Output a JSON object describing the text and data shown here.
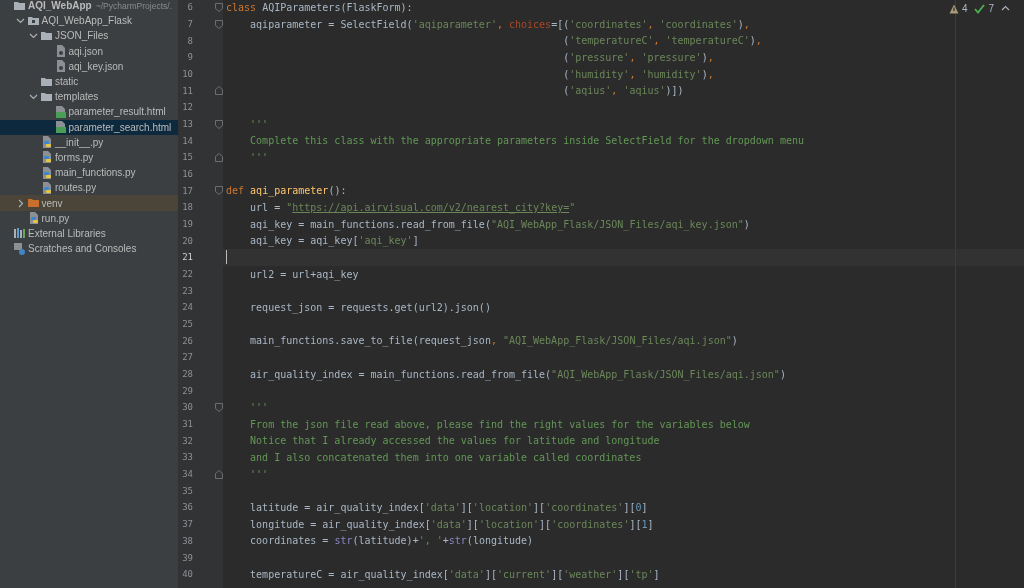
{
  "project_tree": {
    "items": [
      {
        "kind": "project",
        "name": "AQI_WebApp",
        "hint": "~/PycharmProjects/.",
        "selected": false,
        "children": [
          {
            "kind": "module",
            "name": "AQI_WebApp_Flask",
            "expanded": true,
            "selected": false,
            "children": [
              {
                "kind": "folder",
                "name": "JSON_Files",
                "expanded": true,
                "selected": false,
                "children": [
                  {
                    "kind": "json",
                    "name": "aqi.json",
                    "selected": false
                  },
                  {
                    "kind": "json",
                    "name": "aqi_key.json",
                    "selected": false
                  }
                ]
              },
              {
                "kind": "folder",
                "name": "static",
                "selected": false
              },
              {
                "kind": "folder",
                "name": "templates",
                "expanded": true,
                "selected": false,
                "children": [
                  {
                    "kind": "html",
                    "name": "parameter_result.html",
                    "selected": false
                  },
                  {
                    "kind": "html",
                    "name": "parameter_search.html",
                    "selected": true
                  }
                ]
              },
              {
                "kind": "python",
                "name": "__init__.py",
                "selected": false
              },
              {
                "kind": "python",
                "name": "forms.py",
                "selected": false
              },
              {
                "kind": "python",
                "name": "main_functions.py",
                "selected": false
              },
              {
                "kind": "python",
                "name": "routes.py",
                "selected": false
              }
            ]
          },
          {
            "kind": "venv",
            "name": "venv",
            "expanded": false,
            "selected": false
          },
          {
            "kind": "python",
            "name": "run.py",
            "selected": false
          }
        ]
      },
      {
        "kind": "library",
        "name": "External Libraries",
        "selected": false
      },
      {
        "kind": "scratches",
        "name": "Scratches and Consoles",
        "selected": false
      }
    ]
  },
  "inspections": {
    "warnings": "4",
    "weak_warnings": "7"
  },
  "editor": {
    "lines": [
      {
        "number": "6",
        "kind": "fold_start",
        "current": false,
        "tokens": [
          {
            "kind": "kw",
            "text": "class"
          },
          {
            "kind": "plain",
            "text": " AQIParameters(FlaskForm):"
          }
        ]
      },
      {
        "number": "7",
        "kind": "fold_start",
        "current": false,
        "tokens": [
          {
            "kind": "plain",
            "text": "    aqiparameter = SelectField("
          },
          {
            "kind": "str",
            "text": "'aqiparameter'"
          },
          {
            "kind": "kw",
            "text": ", "
          },
          {
            "kind": "param",
            "text": "choices"
          },
          {
            "kind": "plain",
            "text": "=[("
          },
          {
            "kind": "str",
            "text": "'coordinates'"
          },
          {
            "kind": "kw",
            "text": ", "
          },
          {
            "kind": "str",
            "text": "'coordinates'"
          },
          {
            "kind": "plain",
            "text": ")"
          },
          {
            "kind": "kw",
            "text": ","
          }
        ]
      },
      {
        "number": "8",
        "kind": "plain",
        "current": false,
        "tokens": [
          {
            "kind": "plain",
            "text": "                                                        ("
          },
          {
            "kind": "str",
            "text": "'temperatureC'"
          },
          {
            "kind": "kw",
            "text": ", "
          },
          {
            "kind": "str",
            "text": "'temperatureC'"
          },
          {
            "kind": "plain",
            "text": ")"
          },
          {
            "kind": "kw",
            "text": ","
          }
        ]
      },
      {
        "number": "9",
        "kind": "plain",
        "current": false,
        "tokens": [
          {
            "kind": "plain",
            "text": "                                                        ("
          },
          {
            "kind": "str",
            "text": "'pressure'"
          },
          {
            "kind": "kw",
            "text": ", "
          },
          {
            "kind": "str",
            "text": "'pressure'"
          },
          {
            "kind": "plain",
            "text": ")"
          },
          {
            "kind": "kw",
            "text": ","
          }
        ]
      },
      {
        "number": "10",
        "kind": "plain",
        "current": false,
        "tokens": [
          {
            "kind": "plain",
            "text": "                                                        ("
          },
          {
            "kind": "str",
            "text": "'humidity'"
          },
          {
            "kind": "kw",
            "text": ", "
          },
          {
            "kind": "str",
            "text": "'humidity'"
          },
          {
            "kind": "plain",
            "text": ")"
          },
          {
            "kind": "kw",
            "text": ","
          }
        ]
      },
      {
        "number": "11",
        "kind": "fold_end",
        "current": false,
        "tokens": [
          {
            "kind": "plain",
            "text": "                                                        ("
          },
          {
            "kind": "str",
            "text": "'aqius'"
          },
          {
            "kind": "kw",
            "text": ", "
          },
          {
            "kind": "str",
            "text": "'aqius'"
          },
          {
            "kind": "plain",
            "text": ")])"
          }
        ]
      },
      {
        "number": "12",
        "kind": "plain",
        "current": false
      },
      {
        "number": "13",
        "kind": "fold_start",
        "current": false,
        "tokens": [
          {
            "kind": "doc",
            "text": "    '''"
          }
        ]
      },
      {
        "number": "14",
        "kind": "plain",
        "current": false,
        "tokens": [
          {
            "kind": "doc",
            "text": "    Complete this class with the appropriate parameters inside SelectField for the dropdown menu"
          }
        ]
      },
      {
        "number": "15",
        "kind": "fold_end",
        "current": false,
        "tokens": [
          {
            "kind": "doc",
            "text": "    '''"
          }
        ]
      },
      {
        "number": "16",
        "kind": "plain",
        "current": false
      },
      {
        "number": "17",
        "kind": "fold_start",
        "current": false,
        "tokens": [
          {
            "kind": "kw",
            "text": "def "
          },
          {
            "kind": "func",
            "text": "aqi_parameter"
          },
          {
            "kind": "plain",
            "text": "():"
          }
        ]
      },
      {
        "number": "18",
        "kind": "plain",
        "current": false,
        "tokens": [
          {
            "kind": "plain",
            "text": "    url = "
          },
          {
            "kind": "str",
            "text": "\""
          },
          {
            "kind": "link",
            "text": "https://api.airvisual.com/v2/nearest_city?key="
          },
          {
            "kind": "str",
            "text": "\""
          }
        ]
      },
      {
        "number": "19",
        "kind": "plain",
        "current": false,
        "tokens": [
          {
            "kind": "plain",
            "text": "    aqi_key = main_functions.read_from_file("
          },
          {
            "kind": "str",
            "text": "\"AQI_WebApp_Flask/JSON_Files/aqi_key.json\""
          },
          {
            "kind": "plain",
            "text": ")"
          }
        ]
      },
      {
        "number": "20",
        "kind": "plain",
        "current": false,
        "tokens": [
          {
            "kind": "plain",
            "text": "    aqi_key = aqi_key["
          },
          {
            "kind": "str",
            "text": "'aqi_key'"
          },
          {
            "kind": "plain",
            "text": "]"
          }
        ]
      },
      {
        "number": "21",
        "kind": "plain",
        "current": true
      },
      {
        "number": "22",
        "kind": "plain",
        "current": false,
        "tokens": [
          {
            "kind": "plain",
            "text": "    url2 = url+aqi_key"
          }
        ]
      },
      {
        "number": "23",
        "kind": "plain",
        "current": false
      },
      {
        "number": "24",
        "kind": "plain",
        "current": false,
        "tokens": [
          {
            "kind": "plain",
            "text": "    request_json = requests.get(url2).json()"
          }
        ]
      },
      {
        "number": "25",
        "kind": "plain",
        "current": false
      },
      {
        "number": "26",
        "kind": "plain",
        "current": false,
        "tokens": [
          {
            "kind": "plain",
            "text": "    main_functions.save_to_file(request_json"
          },
          {
            "kind": "kw",
            "text": ", "
          },
          {
            "kind": "str",
            "text": "\"AQI_WebApp_Flask/JSON_Files/aqi.json\""
          },
          {
            "kind": "plain",
            "text": ")"
          }
        ]
      },
      {
        "number": "27",
        "kind": "plain",
        "current": false
      },
      {
        "number": "28",
        "kind": "plain",
        "current": false,
        "tokens": [
          {
            "kind": "plain",
            "text": "    air_quality_index = main_functions.read_from_file("
          },
          {
            "kind": "str",
            "text": "\"AQI_WebApp_Flask/JSON_Files/aqi.json\""
          },
          {
            "kind": "plain",
            "text": ")"
          }
        ]
      },
      {
        "number": "29",
        "kind": "plain",
        "current": false
      },
      {
        "number": "30",
        "kind": "fold_start",
        "current": false,
        "tokens": [
          {
            "kind": "doc",
            "text": "    '''"
          }
        ]
      },
      {
        "number": "31",
        "kind": "plain",
        "current": false,
        "tokens": [
          {
            "kind": "doc",
            "text": "    From the json file read above, please find the right values for the variables below"
          }
        ]
      },
      {
        "number": "32",
        "kind": "plain",
        "current": false,
        "tokens": [
          {
            "kind": "doc",
            "text": "    Notice that I already accessed the values for latitude and longitude"
          }
        ]
      },
      {
        "number": "33",
        "kind": "plain",
        "current": false,
        "tokens": [
          {
            "kind": "doc",
            "text": "    and I also concatenated them into one variable called coordinates"
          }
        ]
      },
      {
        "number": "34",
        "kind": "fold_end",
        "current": false,
        "tokens": [
          {
            "kind": "doc",
            "text": "    '''"
          }
        ]
      },
      {
        "number": "35",
        "kind": "plain",
        "current": false
      },
      {
        "number": "36",
        "kind": "plain",
        "current": false,
        "tokens": [
          {
            "kind": "plain",
            "text": "    latitude = air_quality_index["
          },
          {
            "kind": "str",
            "text": "'data'"
          },
          {
            "kind": "plain",
            "text": "]["
          },
          {
            "kind": "str",
            "text": "'location'"
          },
          {
            "kind": "plain",
            "text": "]["
          },
          {
            "kind": "str",
            "text": "'coordinates'"
          },
          {
            "kind": "plain",
            "text": "]["
          },
          {
            "kind": "num",
            "text": "0"
          },
          {
            "kind": "plain",
            "text": "]"
          }
        ]
      },
      {
        "number": "37",
        "kind": "plain",
        "current": false,
        "tokens": [
          {
            "kind": "plain",
            "text": "    longitude = air_quality_index["
          },
          {
            "kind": "str",
            "text": "'data'"
          },
          {
            "kind": "plain",
            "text": "]["
          },
          {
            "kind": "str",
            "text": "'location'"
          },
          {
            "kind": "plain",
            "text": "]["
          },
          {
            "kind": "str",
            "text": "'coordinates'"
          },
          {
            "kind": "plain",
            "text": "]["
          },
          {
            "kind": "num",
            "text": "1"
          },
          {
            "kind": "plain",
            "text": "]"
          }
        ]
      },
      {
        "number": "38",
        "kind": "plain",
        "current": false,
        "tokens": [
          {
            "kind": "plain",
            "text": "    coordinates = "
          },
          {
            "kind": "builtin",
            "text": "str"
          },
          {
            "kind": "plain",
            "text": "(latitude)+"
          },
          {
            "kind": "str",
            "text": "', '"
          },
          {
            "kind": "plain",
            "text": "+"
          },
          {
            "kind": "builtin",
            "text": "str"
          },
          {
            "kind": "plain",
            "text": "(longitude)"
          }
        ]
      },
      {
        "number": "39",
        "kind": "plain",
        "current": false
      },
      {
        "number": "40",
        "kind": "plain",
        "current": false,
        "tokens": [
          {
            "kind": "plain",
            "text": "    temperatureC = air_quality_index["
          },
          {
            "kind": "str",
            "text": "'data'"
          },
          {
            "kind": "plain",
            "text": "]["
          },
          {
            "kind": "str",
            "text": "'current'"
          },
          {
            "kind": "plain",
            "text": "]["
          },
          {
            "kind": "str",
            "text": "'weather'"
          },
          {
            "kind": "plain",
            "text": "]["
          },
          {
            "kind": "str",
            "text": "'tp'"
          },
          {
            "kind": "plain",
            "text": "]"
          }
        ]
      }
    ]
  }
}
